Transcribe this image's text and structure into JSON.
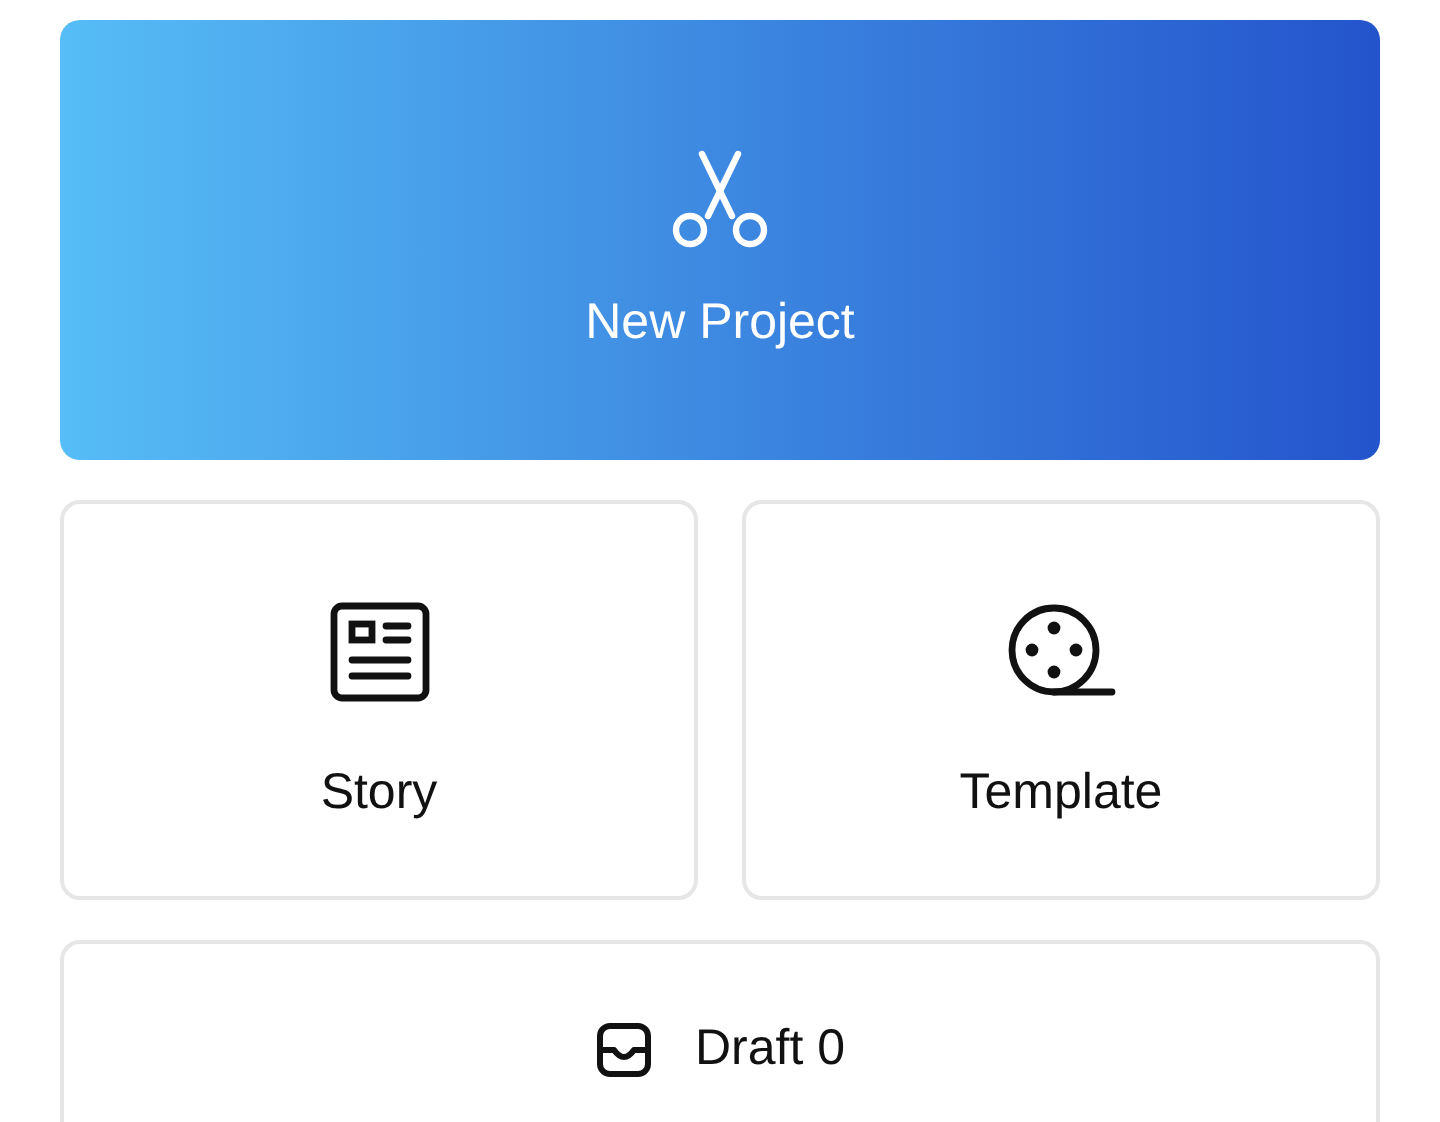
{
  "new_project": {
    "label": "New Project"
  },
  "options": [
    {
      "kind": "document",
      "label": "Story"
    },
    {
      "kind": "reel",
      "label": "Template"
    }
  ],
  "draft": {
    "label": "Draft 0"
  }
}
